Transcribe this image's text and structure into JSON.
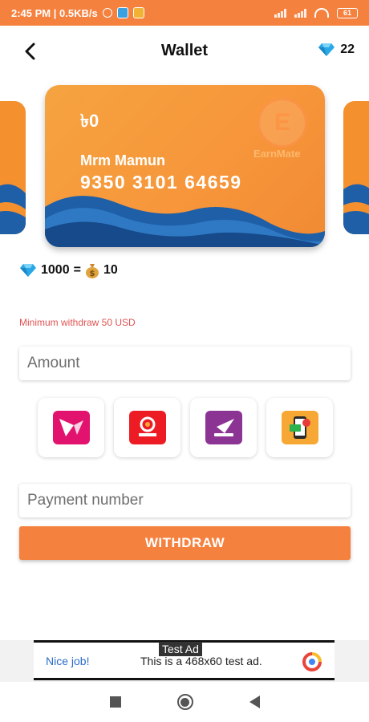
{
  "status_bar": {
    "time_info": "2:45 PM | 0.5KB/s",
    "battery": "61"
  },
  "header": {
    "title": "Wallet",
    "gem_count": "22",
    "back_icon": "arrow-left-icon",
    "gem_icon": "diamond-icon"
  },
  "card": {
    "balance": "৳0",
    "holder_name": "Mrm Mamun",
    "number": "9350 3101 64659",
    "brand_letter": "E",
    "brand_name": "EarnMate"
  },
  "rate": {
    "gems": "1000",
    "equals": "=",
    "money": "10",
    "money_icon": "money-bag-icon"
  },
  "form": {
    "min_withdraw": "Minimum withdraw 50 USD",
    "amount_placeholder": "Amount",
    "payment_placeholder": "Payment number",
    "withdraw_label": "WITHDRAW"
  },
  "payment_methods": [
    {
      "name": "bkash",
      "icon": "bkash-icon",
      "color": "#e2136e"
    },
    {
      "name": "nagad",
      "icon": "nagad-icon",
      "color": "#ed1c24"
    },
    {
      "name": "rocket",
      "icon": "rocket-icon",
      "color": "#8c3494"
    },
    {
      "name": "mobile-recharge",
      "icon": "mobile-recharge-icon",
      "color": "#f7a733"
    }
  ],
  "ad": {
    "label": "Test Ad",
    "nice": "Nice job!",
    "text": "This is a 468x60 test ad."
  },
  "colors": {
    "accent": "#f5813f",
    "card_orange": "#f7953a",
    "wave_blue": "#1e5fa8",
    "error_text": "#e05252"
  }
}
